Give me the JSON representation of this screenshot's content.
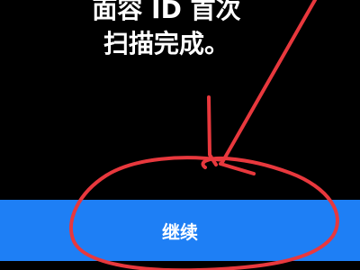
{
  "message": {
    "line1": "面容 ID 首次",
    "line2": "扫描完成。"
  },
  "continue_button": {
    "label": "继续"
  },
  "colors": {
    "background": "#000000",
    "button": "#1e7ff5",
    "text": "#ffffff",
    "annotation": "#e8383d"
  }
}
